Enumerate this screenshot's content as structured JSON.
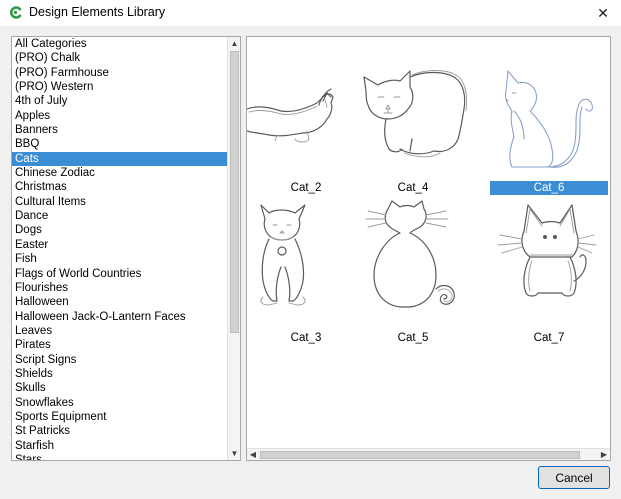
{
  "window": {
    "title": "Design Elements Library",
    "close_glyph": "✕"
  },
  "categories": {
    "items": [
      "All Categories",
      "(PRO) Chalk",
      "(PRO) Farmhouse",
      "(PRO) Western",
      "4th of July",
      "Apples",
      "Banners",
      "BBQ",
      "Cats",
      "Chinese Zodiac",
      "Christmas",
      "Cultural Items",
      "Dance",
      "Dogs",
      "Easter",
      "Fish",
      "Flags of World Countries",
      "Flourishes",
      "Halloween",
      "Halloween Jack-O-Lantern Faces",
      "Leaves",
      "Pirates",
      "Script Signs",
      "Shields",
      "Skulls",
      "Snowflakes",
      "Sports Equipment",
      "St Patricks",
      "Starfish",
      "Stars"
    ],
    "selected": "Cats",
    "scroll_up_glyph": "▲",
    "scroll_down_glyph": "▼"
  },
  "thumbnails": {
    "items": [
      {
        "label": "Cat_2",
        "icon": "cat-stretching-icon"
      },
      {
        "label": "Cat_4",
        "icon": "cat-crouching-icon"
      },
      {
        "label": "Cat_6",
        "icon": "cat-sitting-side-icon"
      },
      {
        "label": "Cat_3",
        "icon": "kitten-sitting-icon"
      },
      {
        "label": "Cat_5",
        "icon": "cat-back-view-icon"
      },
      {
        "label": "Cat_7",
        "icon": "cartoon-cat-icon"
      }
    ],
    "selected": "Cat_6",
    "scroll_left_glyph": "◀",
    "scroll_right_glyph": "▶"
  },
  "buttons": {
    "cancel": "Cancel"
  },
  "colors": {
    "selection": "#3b8ed3",
    "button_border": "#0067c0",
    "app_icon": "#2e9a47"
  }
}
